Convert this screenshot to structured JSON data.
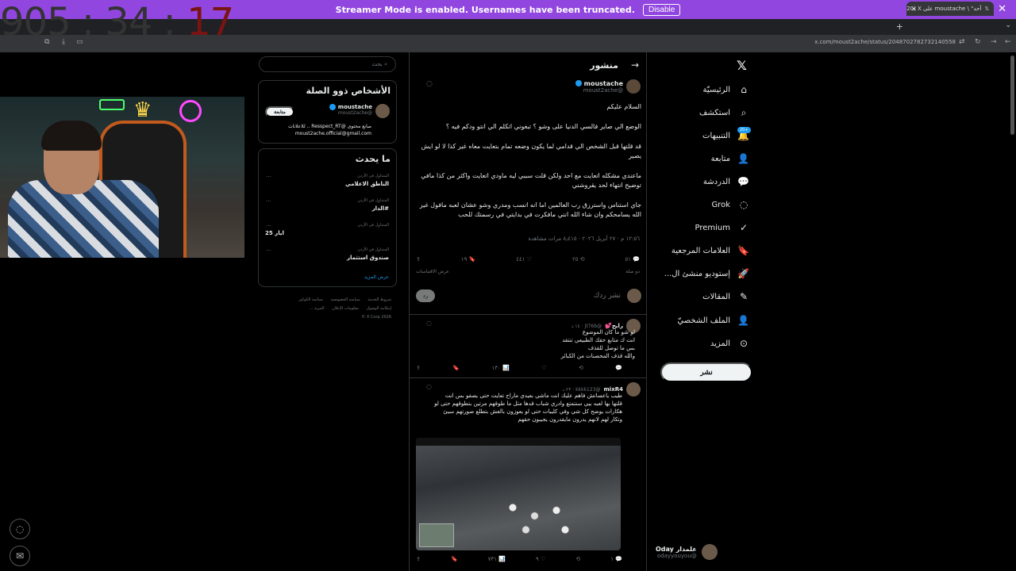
{
  "banner": {
    "text": "Streamer Mode is enabled. Usernames have been truncated.",
    "button": "Disable"
  },
  "browser": {
    "tab_title": "(20) X على moustache \\ \"أحد",
    "url": "x.com/moust2ache/status/2048702782732140558"
  },
  "timer": {
    "main": "905 : 34 : ",
    "seconds": "17"
  },
  "nav": {
    "items": [
      {
        "label": "الرئيسيّة",
        "icon": "home-icon",
        "glyph": "⌂"
      },
      {
        "label": "استكشف",
        "icon": "search-icon",
        "glyph": "⌕"
      },
      {
        "label": "التنبيهات",
        "icon": "bell-icon",
        "glyph": "🔔"
      },
      {
        "label": "متابعة",
        "icon": "follow-icon",
        "glyph": "👤"
      },
      {
        "label": "الدردشة",
        "icon": "chat-icon",
        "glyph": "💬"
      },
      {
        "label": "Grok",
        "icon": "grok-icon",
        "glyph": "◌"
      },
      {
        "label": "Premium",
        "icon": "premium-icon",
        "glyph": "✓"
      },
      {
        "label": "العلامات المرجعية",
        "icon": "bookmark-icon",
        "glyph": "🔖"
      },
      {
        "label": "إستوديو منشئ ال...",
        "icon": "rocket-icon",
        "glyph": "🚀"
      },
      {
        "label": "المقالات",
        "icon": "article-icon",
        "glyph": "✎"
      },
      {
        "label": "الملف الشخصيّ",
        "icon": "profile-icon",
        "glyph": "👤"
      },
      {
        "label": "المزيد",
        "icon": "more-icon",
        "glyph": "⊙"
      }
    ],
    "badge": "20+",
    "post_button": "نشر",
    "account": {
      "name": "علمدار Oday",
      "handle": "@odayyouyou"
    }
  },
  "main": {
    "header_title": "منشور",
    "post": {
      "author": "moustache",
      "handle": "@moust2ache",
      "paragraphs": [
        "السلام عليكم",
        "الوضع الي صاير فالسي الدنيا على وشو ؟ تبغوني اتكلم الي انتو ودكم فيه ؟",
        "قد قلتها قبل الشخص الي قدامي لما يكون وضعه تمام بتعايت معاه غير كذا لا لو ايش يصير",
        "ماعندي مشكله اتعايت مع احد ولكن قلت سببي ليه ماودي اتعايت واكثر من كذا مافي توضيح انتهاء لحد يقروشني",
        "جاي استناس واسترزق رب العالمين اما انه انسب ومدري وشو عشان لعبه مافول غير الله يسامحكم وان شاء الله انني مافكرت في بدايتي في رسمتك للحب"
      ],
      "meta": "١٢:٥٦ م · ٢٧ أبريل ٢٠٢٦ · ٨٫٤١٥ مرات مشاهدة",
      "actions": {
        "replies": "٥١",
        "reposts": "٢٥",
        "likes": "٤٤١",
        "bookmarks": "١٩"
      },
      "subrow_left": "ذو صلة",
      "subrow_right": "عرض الاقتباسات",
      "reply_placeholder": "نشر ردك",
      "reply_button": "رد"
    },
    "replies": [
      {
        "name": "رايح💕",
        "handle": "@Jt76b · ١٤ د",
        "lines": [
          "لو شو ما كان الموضوع",
          "انت ك متابع حقك الطبيعي تنتقد",
          "بس ما توصل للقذف",
          "والله قذف المحصنات من الكبائر"
        ],
        "actions": {
          "replies": "",
          "reposts": "",
          "likes": "",
          "views": "١٣٠"
        }
      },
      {
        "name": "mixR4",
        "handle": "@kkkk123 · ٢٣ د",
        "lines": [
          "طيب ياعساتش فاهم عليك انت ماشي بعيدي ماراح تعايت حتى يصفو بس انت",
          "قلتها بها لعبه بيي سنتمتع وادري شباب قدها مثل ما طوقهم مرتين بتطوقهم حتى لو",
          "هكارات يوضح كل شي وفي كليبات حتى لو يعوزون بالغش بتطلع صورتهم سيئ",
          "وتكار لهم لانهم يدرون مايقدرون يجيبون حقهم"
        ],
        "actions": {
          "replies": "١",
          "reposts": "",
          "likes": "٩",
          "views": "٧٣١"
        }
      }
    ]
  },
  "sidebar": {
    "search_placeholder": "بحث",
    "who_title": "الأشخاص ذوو الصلة",
    "follow_button": "متابعة",
    "user": {
      "name": "moustache",
      "handle": "@moust2ache",
      "bio1": "صانع محتوى @Resspect_RT .. للاعلانات",
      "bio2": "moust2ache.official@gmail.com"
    },
    "trends_title": "ما يحدث",
    "trends": [
      {
        "context": "المتداول في الأردن",
        "name": "الناطق الاعلامي"
      },
      {
        "context": "المتداول في الأردن",
        "name": "#الدار"
      },
      {
        "context": "المتداول في الأردن",
        "name": "ايار 25"
      },
      {
        "context": "المتداول في الأردن",
        "name": "صندوق استثمار"
      }
    ],
    "show_more": "عرض المزيد",
    "footer1": [
      "شروط الخدمة",
      "سياسة الخصوصية",
      "سياسة الكوكيز"
    ],
    "footer2": [
      "إمكانية الوصول",
      "معلومات الإعلان",
      "المزيد ..."
    ],
    "copyright": "X Corp 2026 ©"
  }
}
